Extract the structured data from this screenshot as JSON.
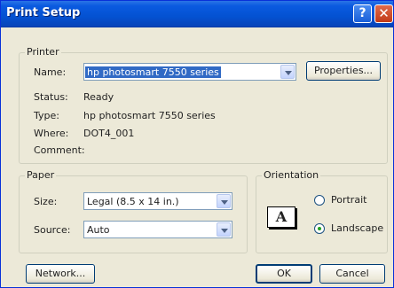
{
  "window": {
    "title": "Print Setup",
    "help_glyph": "?",
    "close_glyph": "✕"
  },
  "printer": {
    "group_label": "Printer",
    "name_label": "Name:",
    "name_value": "hp photosmart 7550 series",
    "properties_label": "Properties...",
    "status_label": "Status:",
    "status_value": "Ready",
    "type_label": "Type:",
    "type_value": "hp photosmart 7550 series",
    "where_label": "Where:",
    "where_value": "DOT4_001",
    "comment_label": "Comment:",
    "comment_value": ""
  },
  "paper": {
    "group_label": "Paper",
    "size_label": "Size:",
    "size_value": "Legal (8.5 x 14 in.)",
    "source_label": "Source:",
    "source_value": "Auto"
  },
  "orientation": {
    "group_label": "Orientation",
    "icon_glyph": "A",
    "portrait_label": "Portrait",
    "landscape_label": "Landscape",
    "selected": "landscape"
  },
  "buttons": {
    "network_label": "Network...",
    "ok_label": "OK",
    "cancel_label": "Cancel"
  }
}
